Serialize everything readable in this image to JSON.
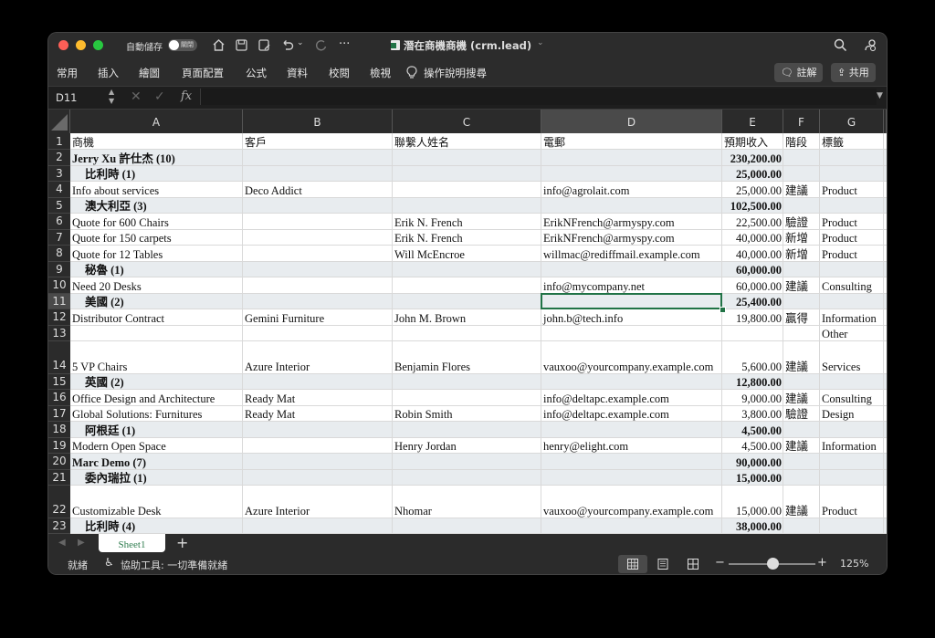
{
  "titlebar": {
    "autosave_label": "自動儲存",
    "toggle_label": "關閉",
    "doc_title": "潛在商機商機 (crm.lead)",
    "more": "···"
  },
  "ribbon": {
    "tabs": [
      "常用",
      "插入",
      "繪圖",
      "頁面配置",
      "公式",
      "資料",
      "校閱",
      "檢視"
    ],
    "tell_me": "操作說明搜尋",
    "comment_label": "註解",
    "share_label": "共用"
  },
  "formula_bar": {
    "name_box": "D11",
    "fx": "fx",
    "value": ""
  },
  "columns": [
    "A",
    "B",
    "C",
    "D",
    "E",
    "F",
    "G"
  ],
  "rows": [
    {
      "n": "1",
      "h": 18,
      "a": "商機",
      "b": "客戶",
      "c": "聯繫人姓名",
      "d": "電郵",
      "e": "預期收入",
      "f": "階段",
      "g": "標籤",
      "type": "header"
    },
    {
      "n": "2",
      "h": 17.5,
      "a": "Jerry Xu 許仕杰 (10)",
      "b": "",
      "c": "",
      "d": "",
      "e": "230,200.00",
      "f": "",
      "g": "",
      "type": "group"
    },
    {
      "n": "3",
      "h": 17.5,
      "a": "比利時 (1)",
      "b": "",
      "c": "",
      "d": "",
      "e": "25,000.00",
      "f": "",
      "g": "",
      "type": "sub"
    },
    {
      "n": "4",
      "h": 17.5,
      "a": "Info about services",
      "b": "Deco Addict",
      "c": "",
      "d": "info@agrolait.com",
      "e": "25,000.00",
      "f": "建議",
      "g": "Product",
      "type": "data"
    },
    {
      "n": "5",
      "h": 17.5,
      "a": "澳大利亞 (3)",
      "b": "",
      "c": "",
      "d": "",
      "e": "102,500.00",
      "f": "",
      "g": "",
      "type": "sub"
    },
    {
      "n": "6",
      "h": 17.5,
      "a": "Quote for 600 Chairs",
      "b": "",
      "c": "Erik N. French",
      "d": "ErikNFrench@armyspy.com",
      "e": "22,500.00",
      "f": "驗證",
      "g": "Product",
      "type": "data"
    },
    {
      "n": "7",
      "h": 17.5,
      "a": "Quote for 150 carpets",
      "b": "",
      "c": "Erik N. French",
      "d": "ErikNFrench@armyspy.com",
      "e": "40,000.00",
      "f": "新增",
      "g": "Product",
      "type": "data"
    },
    {
      "n": "8",
      "h": 17.5,
      "a": "Quote for 12 Tables",
      "b": "",
      "c": "Will McEncroe",
      "d": "willmac@rediffmail.example.com",
      "e": "40,000.00",
      "f": "新增",
      "g": "Product",
      "type": "data"
    },
    {
      "n": "9",
      "h": 17.5,
      "a": "秘魯 (1)",
      "b": "",
      "c": "",
      "d": "",
      "e": "60,000.00",
      "f": "",
      "g": "",
      "type": "sub"
    },
    {
      "n": "10",
      "h": 17.5,
      "a": "Need 20 Desks",
      "b": "",
      "c": "",
      "d": "info@mycompany.net",
      "e": "60,000.00",
      "f": "建議",
      "g": "Consulting",
      "type": "data"
    },
    {
      "n": "11",
      "h": 17.5,
      "a": "美國 (2)",
      "b": "",
      "c": "",
      "d": "",
      "e": "25,400.00",
      "f": "",
      "g": "",
      "type": "sub"
    },
    {
      "n": "12",
      "h": 17.5,
      "a": "Distributor Contract",
      "b": "Gemini Furniture",
      "c": "John M. Brown",
      "d": "john.b@tech.info",
      "e": "19,800.00",
      "f": "贏得",
      "g": "Information",
      "type": "data"
    },
    {
      "n": "13",
      "h": 17.5,
      "a": "",
      "b": "",
      "c": "",
      "d": "",
      "e": "",
      "f": "",
      "g": "Other",
      "type": "data"
    },
    {
      "n": "14",
      "h": 35.5,
      "a": "5 VP Chairs",
      "b": "Azure Interior",
      "c": "Benjamin Flores",
      "d": "vauxoo@yourcompany.example.com",
      "e": "5,600.00",
      "f": "建議",
      "g": "Services",
      "type": "data"
    },
    {
      "n": "15",
      "h": 17.5,
      "a": "英國 (2)",
      "b": "",
      "c": "",
      "d": "",
      "e": "12,800.00",
      "f": "",
      "g": "",
      "type": "sub"
    },
    {
      "n": "16",
      "h": 17.5,
      "a": "Office Design and Architecture",
      "b": "Ready Mat",
      "c": "",
      "d": "info@deltapc.example.com",
      "e": "9,000.00",
      "f": "建議",
      "g": "Consulting",
      "type": "data"
    },
    {
      "n": "17",
      "h": 17.5,
      "a": "Global Solutions: Furnitures",
      "b": "Ready Mat",
      "c": "Robin Smith",
      "d": "info@deltapc.example.com",
      "e": "3,800.00",
      "f": "驗證",
      "g": "Design",
      "type": "data"
    },
    {
      "n": "18",
      "h": 17.5,
      "a": "阿根廷 (1)",
      "b": "",
      "c": "",
      "d": "",
      "e": "4,500.00",
      "f": "",
      "g": "",
      "type": "sub"
    },
    {
      "n": "19",
      "h": 17.5,
      "a": "Modern Open Space",
      "b": "",
      "c": "Henry Jordan",
      "d": "henry@elight.com",
      "e": "4,500.00",
      "f": "建議",
      "g": "Information",
      "type": "data"
    },
    {
      "n": "20",
      "h": 17.5,
      "a": "Marc Demo (7)",
      "b": "",
      "c": "",
      "d": "",
      "e": "90,000.00",
      "f": "",
      "g": "",
      "type": "group"
    },
    {
      "n": "21",
      "h": 17.5,
      "a": "委內瑞拉 (1)",
      "b": "",
      "c": "",
      "d": "",
      "e": "15,000.00",
      "f": "",
      "g": "",
      "type": "sub"
    },
    {
      "n": "22",
      "h": 35.5,
      "a": "Customizable Desk",
      "b": "Azure Interior",
      "c": "Nhomar",
      "d": "vauxoo@yourcompany.example.com",
      "e": "15,000.00",
      "f": "建議",
      "g": "Product",
      "type": "data"
    },
    {
      "n": "23",
      "h": 17.5,
      "a": "比利時 (4)",
      "b": "",
      "c": "",
      "d": "",
      "e": "38,000.00",
      "f": "",
      "g": "",
      "type": "sub"
    }
  ],
  "sheet": {
    "name": "Sheet1",
    "add": "+"
  },
  "status": {
    "ready": "就緒",
    "accessibility": "協助工具: 一切準備就緒",
    "zoom": "125%",
    "zoom_minus": "−",
    "zoom_plus": "+"
  },
  "colors": {
    "accent": "#217346",
    "group_fill": "#e8ecef",
    "selection": "#217346"
  }
}
